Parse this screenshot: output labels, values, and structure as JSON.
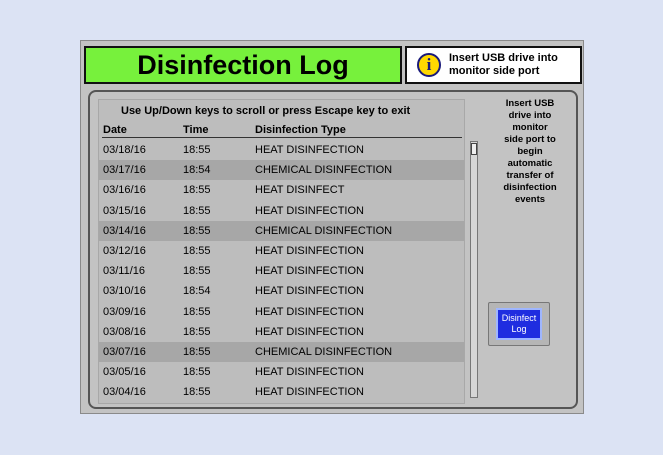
{
  "header": {
    "title": "Disinfection Log",
    "info_line1": "Insert USB drive into",
    "info_line2": "monitor side port"
  },
  "log": {
    "instruction": "Use Up/Down keys to scroll or press Escape key to exit",
    "columns": [
      "Date",
      "Time",
      "Disinfection Type"
    ],
    "rows": [
      {
        "date": "03/18/16",
        "time": "18:55",
        "type": "HEAT DISINFECTION",
        "highlight": false
      },
      {
        "date": "03/17/16",
        "time": "18:54",
        "type": "CHEMICAL DISINFECTION",
        "highlight": true
      },
      {
        "date": "03/16/16",
        "time": "18:55",
        "type": "HEAT DISINFECT",
        "highlight": false
      },
      {
        "date": "03/15/16",
        "time": "18:55",
        "type": "HEAT DISINFECTION",
        "highlight": false
      },
      {
        "date": "03/14/16",
        "time": "18:55",
        "type": "CHEMICAL DISINFECTION",
        "highlight": true
      },
      {
        "date": "03/12/16",
        "time": "18:55",
        "type": "HEAT DISINFECTION",
        "highlight": false
      },
      {
        "date": "03/11/16",
        "time": "18:55",
        "type": "HEAT DISINFECTION",
        "highlight": false
      },
      {
        "date": "03/10/16",
        "time": "18:54",
        "type": "HEAT DISINFECTION",
        "highlight": false
      },
      {
        "date": "03/09/16",
        "time": "18:55",
        "type": "HEAT DISINFECTION",
        "highlight": false
      },
      {
        "date": "03/08/16",
        "time": "18:55",
        "type": "HEAT DISINFECTION",
        "highlight": false
      },
      {
        "date": "03/07/16",
        "time": "18:55",
        "type": "CHEMICAL DISINFECTION",
        "highlight": true
      },
      {
        "date": "03/05/16",
        "time": "18:55",
        "type": "HEAT DISINFECTION",
        "highlight": false
      },
      {
        "date": "03/04/16",
        "time": "18:55",
        "type": "HEAT DISINFECTION",
        "highlight": false
      }
    ]
  },
  "sidebar": {
    "message_lines": [
      "Insert USB",
      "drive into",
      "monitor",
      "side port to",
      "begin",
      "automatic",
      "transfer of",
      "disinfection",
      "events"
    ],
    "button_line1": "Disinfect",
    "button_line2": "Log"
  },
  "icons": {
    "info": "info-icon"
  },
  "colors": {
    "title_bg": "#77f13c",
    "button_bg": "#1f2de0",
    "highlight_row": "#a7a7a7"
  }
}
